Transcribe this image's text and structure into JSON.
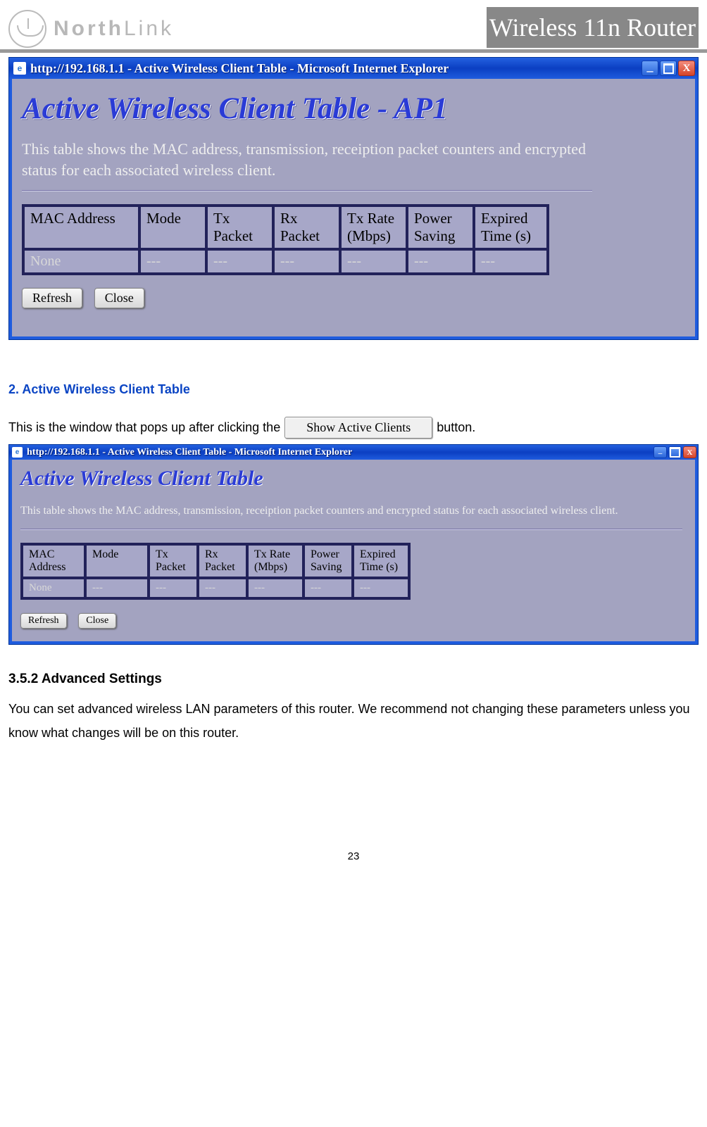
{
  "brand": {
    "name1": "North",
    "name2": "Link",
    "title": "Wireless 11n Router"
  },
  "win1": {
    "title": "http://192.168.1.1 - Active Wireless Client Table - Microsoft Internet Explorer",
    "heading": "Active Wireless Client Table - AP1",
    "desc": "This table shows the MAC address, transmission, receiption packet counters and encrypted status for each associated wireless client.",
    "cols": [
      "MAC Address",
      "Mode",
      "Tx Packet",
      "Rx Packet",
      "Tx Rate (Mbps)",
      "Power Saving",
      "Expired Time (s)"
    ],
    "row": [
      "None",
      "---",
      "---",
      "---",
      "---",
      "---",
      "---"
    ],
    "refresh": "Refresh",
    "close": "Close"
  },
  "section2_title": "2. Active Wireless Client Table",
  "section2_text_before": "This is the window that pops up after clicking the ",
  "section2_btn": "Show Active Clients",
  "section2_text_after": " button.",
  "win2": {
    "title": "http://192.168.1.1 - Active Wireless Client Table - Microsoft Internet Explorer",
    "heading": "Active Wireless Client Table",
    "desc": "This table shows the MAC address, transmission, receiption packet counters and encrypted status for each associated wireless client.",
    "cols": [
      "MAC Address",
      "Mode",
      "Tx Packet",
      "Rx Packet",
      "Tx Rate (Mbps)",
      "Power Saving",
      "Expired Time (s)"
    ],
    "row": [
      "None",
      "---",
      "---",
      "---",
      "---",
      "---",
      "---"
    ],
    "refresh": "Refresh",
    "close": "Close"
  },
  "section3_title": "3.5.2  Advanced Settings",
  "section3_body": "You can set advanced wireless LAN parameters of this router. We recommend not changing these parameters unless you know what changes will be on this router.",
  "pagenum": "23"
}
